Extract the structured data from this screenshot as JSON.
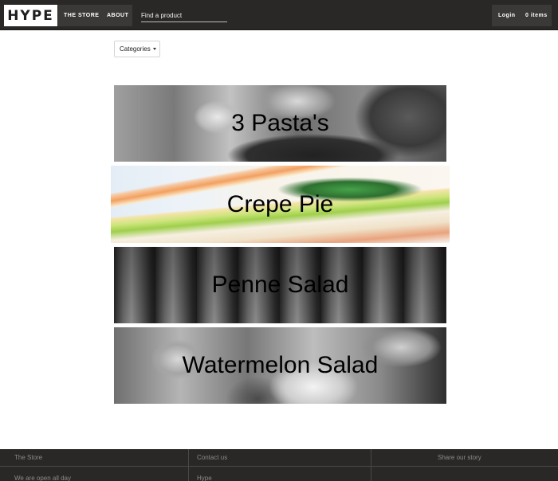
{
  "header": {
    "logo": "HYPE",
    "nav": {
      "store": "THE STORE",
      "about": "ABOUT"
    },
    "search": {
      "placeholder": "Find a product",
      "value": ""
    },
    "login": "Login",
    "cart": "0 items"
  },
  "toolbar": {
    "categories_label": "Categories"
  },
  "products": [
    {
      "label": "3 Pasta's"
    },
    {
      "label": "Crepe Pie"
    },
    {
      "label": "Penne Salad"
    },
    {
      "label": "Watermelon Salad"
    }
  ],
  "footer": {
    "col1": "The Store",
    "col2": "Contact us",
    "col3": "Share our story",
    "row2_col1": "We are open all day",
    "row2_col2": "Hype"
  },
  "icons": {
    "categories_caret": "caret-down-icon"
  },
  "colors": {
    "header_bg": "#2a2827",
    "nav_block": "#3b3937",
    "footer_bg": "#2a2827",
    "footer_text": "#8c8a88"
  }
}
